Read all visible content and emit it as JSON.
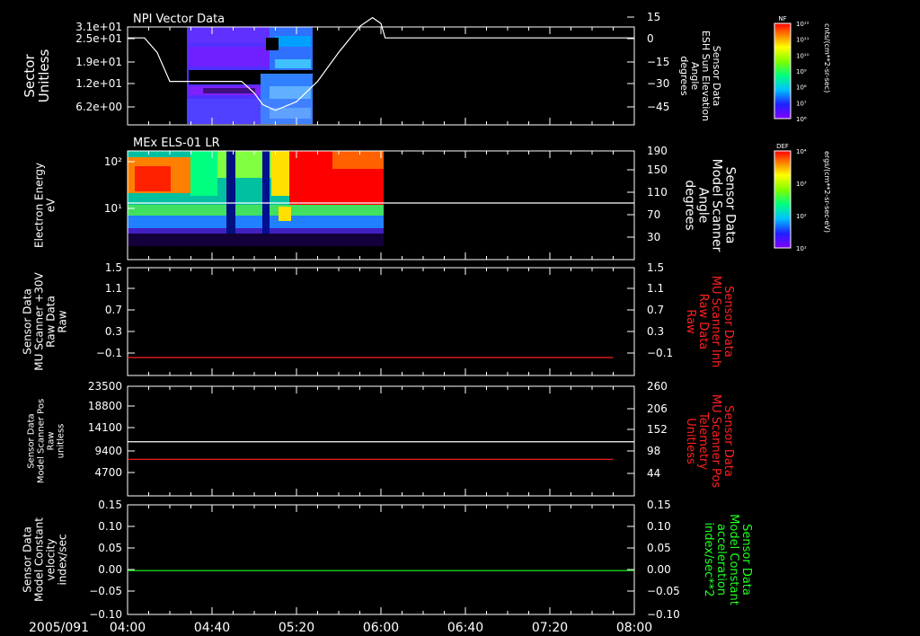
{
  "date_label": "2005/091",
  "x_ticks": [
    "04:00",
    "04:40",
    "05:20",
    "06:00",
    "06:40",
    "07:20",
    "08:00"
  ],
  "colorbars": [
    {
      "tag": "NF",
      "unit": "cnts/(cm**2-sr-sec)",
      "ticks": [
        "10¹²",
        "10¹¹",
        "10¹⁰",
        "10⁹",
        "10⁸",
        "10⁷",
        "10⁶"
      ]
    },
    {
      "tag": "DEF",
      "unit": "ergs/(cm**2-sr-sec-eV)",
      "ticks": [
        "10⁴",
        "10³",
        "10²",
        "10¹"
      ]
    }
  ],
  "colors": {
    "white": "#ffffff",
    "red": "#ff2020",
    "green": "#20ff20"
  },
  "chart_data": [
    {
      "type": "heatmap",
      "title": "NPI Vector Data",
      "ylabel": [
        "Sector",
        "Unitless"
      ],
      "y_ticks": [
        "3.1e+01",
        "2.5e+01",
        "1.9e+01",
        "1.2e+01",
        "6.2e+00"
      ],
      "right_ylabel": [
        "Sensor Data",
        "ESH Sun Elevation",
        "Angle",
        "degrees"
      ],
      "right_y_ticks": [
        "15",
        "0",
        "−15",
        "−30",
        "−45"
      ],
      "right_ylim": [
        -60,
        15
      ],
      "overlay_line": {
        "color": "white",
        "time": [
          "04:00",
          "04:08",
          "04:14",
          "04:20",
          "04:30",
          "04:34",
          "04:44",
          "04:54",
          "05:00",
          "05:04",
          "05:10",
          "05:20",
          "05:30",
          "05:40",
          "05:50",
          "05:56",
          "06:00",
          "06:02",
          "06:14",
          "07:00",
          "08:00"
        ],
        "value": [
          0,
          0,
          -10,
          -30,
          -30,
          -30,
          -30,
          -30,
          -38,
          -46,
          -50,
          -44,
          -30,
          -10,
          8,
          14,
          10,
          0,
          0,
          0,
          0
        ]
      }
    },
    {
      "type": "heatmap",
      "title": "MEx ELS-01 LR",
      "ylabel": [
        "Electron Energy",
        "eV"
      ],
      "y_ticks": [
        "10²",
        "10¹"
      ],
      "right_ylabel": [
        "Sensor Data",
        "Model Scanner",
        "Angle",
        "degrees"
      ],
      "right_y_ticks": [
        "190",
        "150",
        "110",
        "70",
        "30"
      ],
      "overlay_line": {
        "color": "white",
        "value": 95
      }
    },
    {
      "type": "line",
      "ylabel": [
        "Sensor Data",
        "MU Scanner +30V",
        "Raw Data",
        "Raw"
      ],
      "y_ticks": [
        "1.5",
        "1.1",
        "0.7",
        "0.3",
        "−0.1"
      ],
      "right_ylabel": [
        "Sensor Data",
        "MU Scanner Inh",
        "Raw Data",
        "Raw"
      ],
      "right_y_ticks": [
        "1.5",
        "1.1",
        "0.7",
        "0.3",
        "−0.1"
      ],
      "ylim": [
        -0.3,
        1.5
      ],
      "series": [
        {
          "color": "red",
          "x_range": [
            "04:00",
            "07:50"
          ],
          "value": 0.0
        }
      ]
    },
    {
      "type": "line",
      "ylabel": [
        "Sensor Data",
        "Model Scanner Pos",
        "Raw",
        "unitless"
      ],
      "y_ticks": [
        "23500",
        "18800",
        "14100",
        "9400",
        "4700"
      ],
      "right_ylabel": [
        "Sensor Data",
        "MU Scanner Pos",
        "Telemetry",
        "Unitless"
      ],
      "right_y_ticks": [
        "260",
        "206",
        "152",
        "98",
        "44"
      ],
      "ylim": [
        0,
        23500
      ],
      "right_ylim": [
        -10,
        260
      ],
      "series": [
        {
          "color": "white",
          "x_range": [
            "04:00",
            "08:00"
          ],
          "value": 11600
        },
        {
          "color": "red",
          "x_range": [
            "04:00",
            "07:50"
          ],
          "value": 80
        }
      ]
    },
    {
      "type": "line",
      "ylabel": [
        "Sensor Data",
        "Model Constant",
        "velocity",
        "index/sec"
      ],
      "y_ticks": [
        "0.15",
        "0.10",
        "0.05",
        "0.00",
        "−0.05",
        "−0.10"
      ],
      "right_ylabel": [
        "Sensor Data",
        "Model Constant",
        "acceleration",
        "index/sec**2"
      ],
      "right_y_ticks": [
        "0.15",
        "0.10",
        "0.05",
        "0.00",
        "−0.05",
        "−0.10"
      ],
      "ylim": [
        -0.1,
        0.15
      ],
      "series": [
        {
          "color": "green",
          "x_range": [
            "04:00",
            "08:00"
          ],
          "value": 0.0
        }
      ]
    }
  ]
}
